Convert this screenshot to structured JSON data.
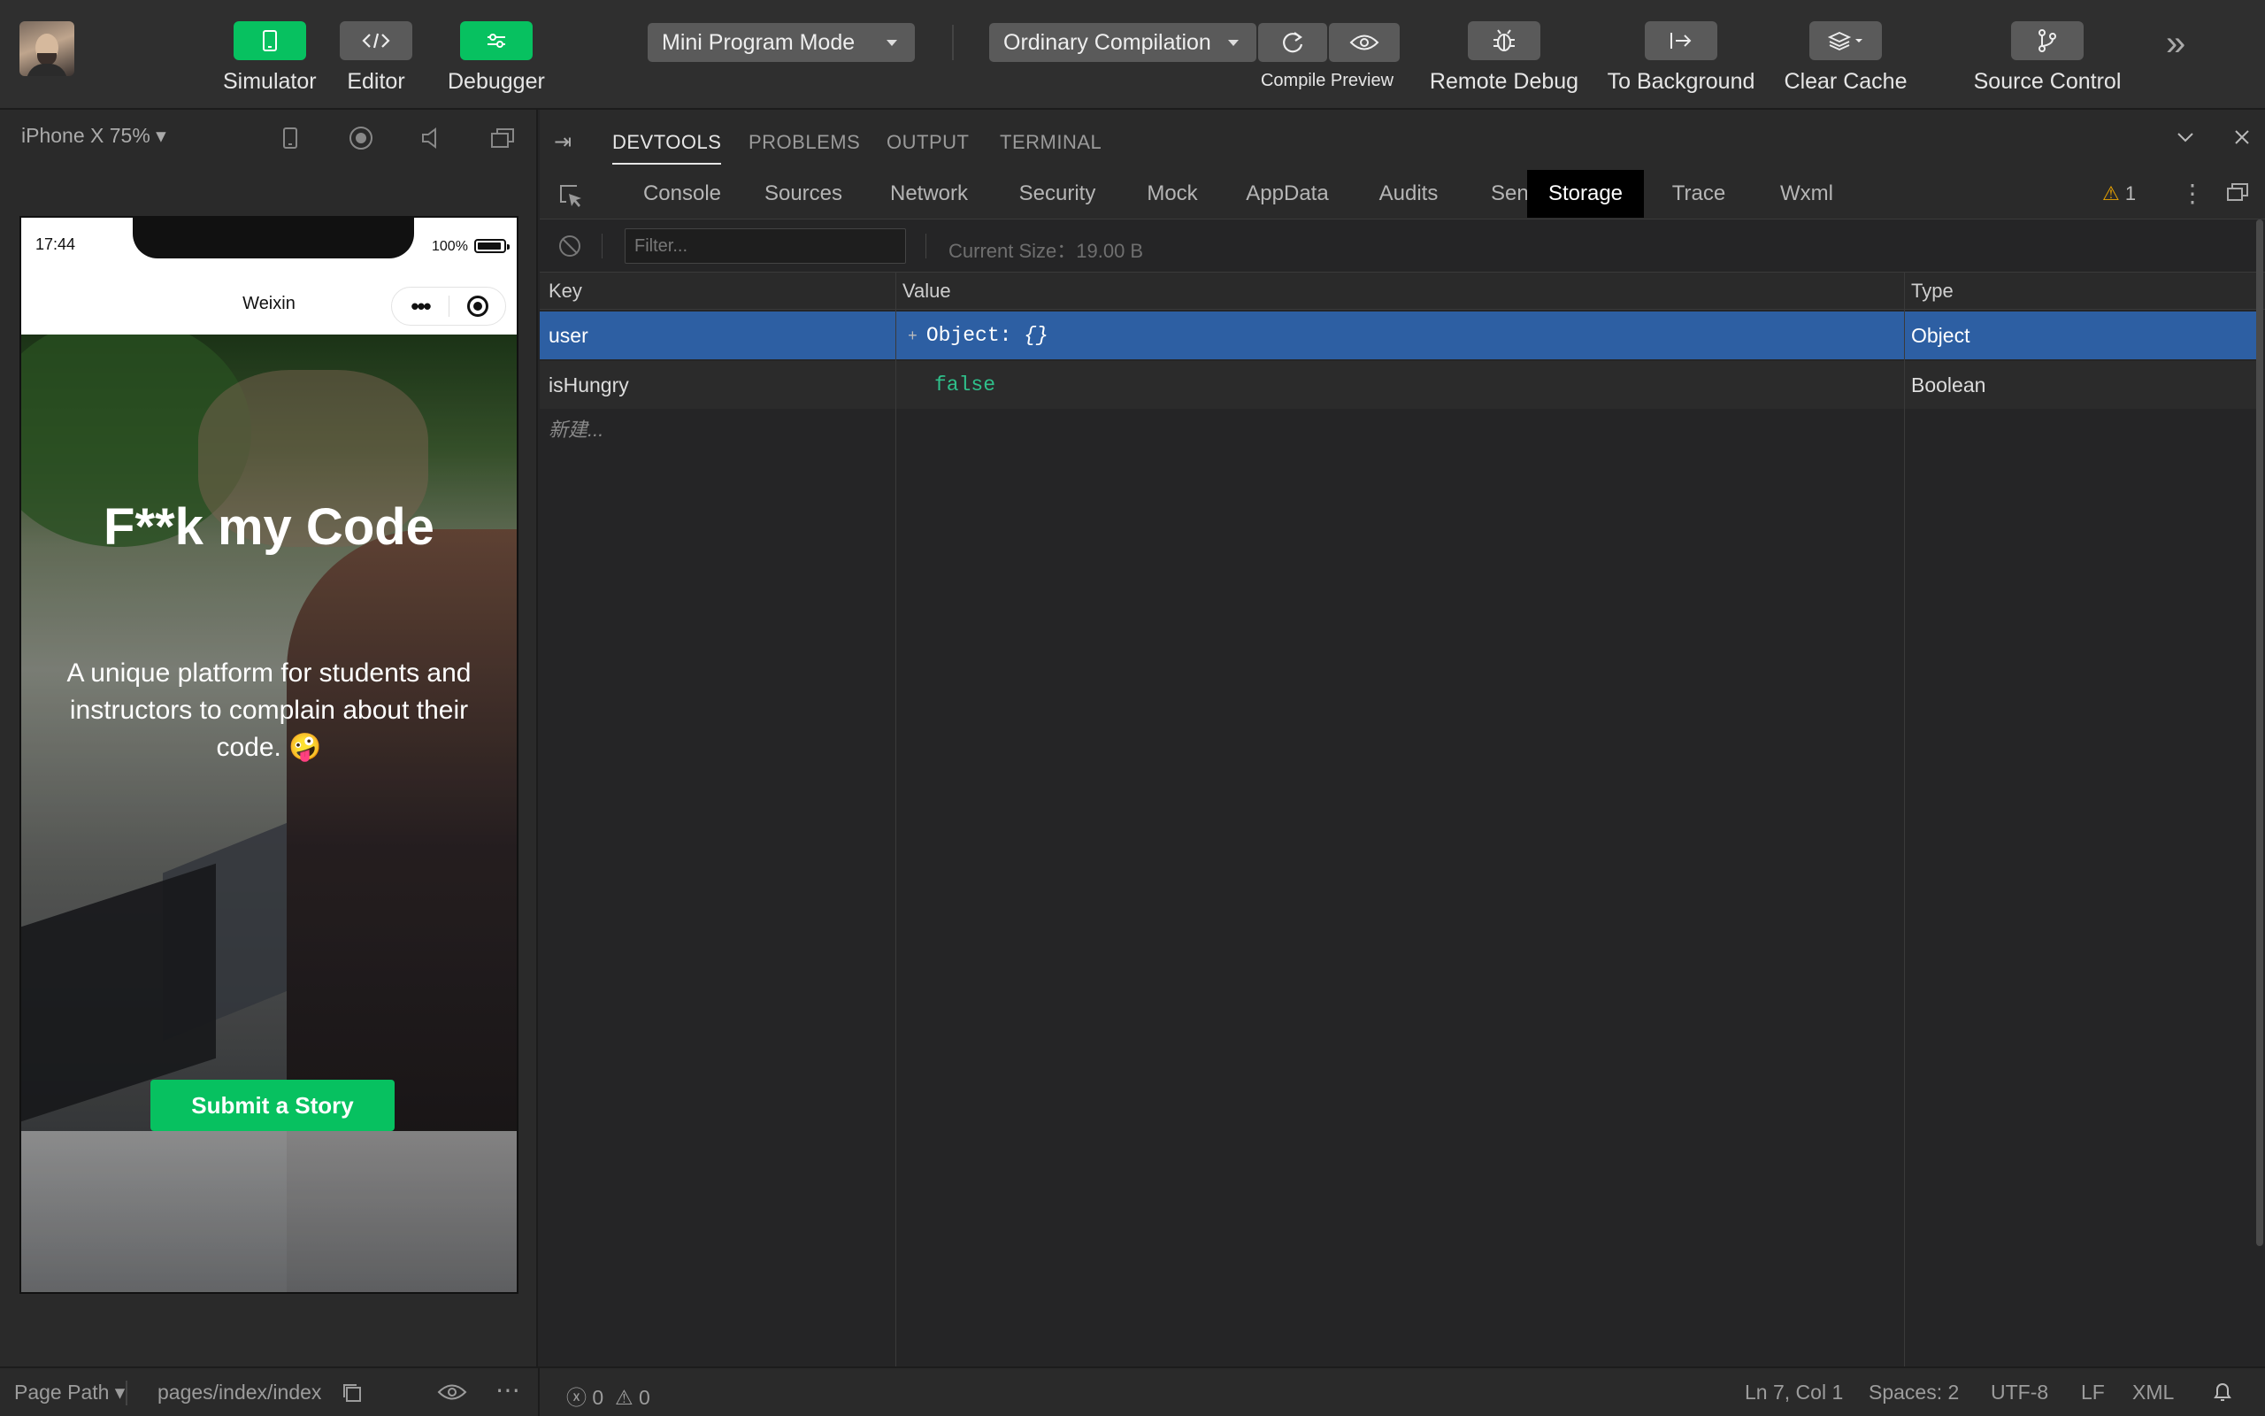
{
  "toolbar": {
    "simulator_label": "Simulator",
    "editor_label": "Editor",
    "debugger_label": "Debugger",
    "mode_select": "Mini Program Mode",
    "compile_select": "Ordinary Compilation",
    "compile_preview_label": "Compile Preview",
    "remote_debug_label": "Remote Debug",
    "to_background_label": "To Background",
    "clear_cache_label": "Clear Cache",
    "source_control_label": "Source Control",
    "accent_color": "#07c160"
  },
  "simulator": {
    "device": "iPhone X 75%",
    "phone": {
      "time": "17:44",
      "battery": "100%",
      "nav_title": "Weixin",
      "hero_title": "F**k my Code",
      "hero_subtitle": "A unique platform for students and instructors to complain about their code. 🤪",
      "submit_button": "Submit a Story"
    }
  },
  "devtools": {
    "panel_tabs": [
      "DEVTOOLS",
      "PROBLEMS",
      "OUTPUT",
      "TERMINAL"
    ],
    "active_panel_tab": "DEVTOOLS",
    "tabs": [
      "Console",
      "Sources",
      "Network",
      "Security",
      "Mock",
      "AppData",
      "Audits",
      "Sensor",
      "Storage",
      "Trace",
      "Wxml"
    ],
    "active_tab": "Storage",
    "warning_count": "1",
    "filter_placeholder": "Filter...",
    "current_size": "Current Size：19.00 B",
    "columns": {
      "key": "Key",
      "value": "Value",
      "type": "Type"
    },
    "rows": [
      {
        "key": "user",
        "value_prefix": "Object: ",
        "value_suffix": "{}",
        "type": "Object",
        "selected": true
      },
      {
        "key": "isHungry",
        "value": "false",
        "type": "Boolean",
        "selected": false
      }
    ],
    "new_item_placeholder": "新建...",
    "selected_row_color": "#2d5fa3"
  },
  "statusbar": {
    "page_path_label": "Page Path",
    "page_path_value": "pages/index/index",
    "errors": "0",
    "warnings": "0",
    "cursor": "Ln 7, Col 1",
    "spaces": "Spaces: 2",
    "encoding": "UTF-8",
    "eol": "LF",
    "language": "XML"
  }
}
